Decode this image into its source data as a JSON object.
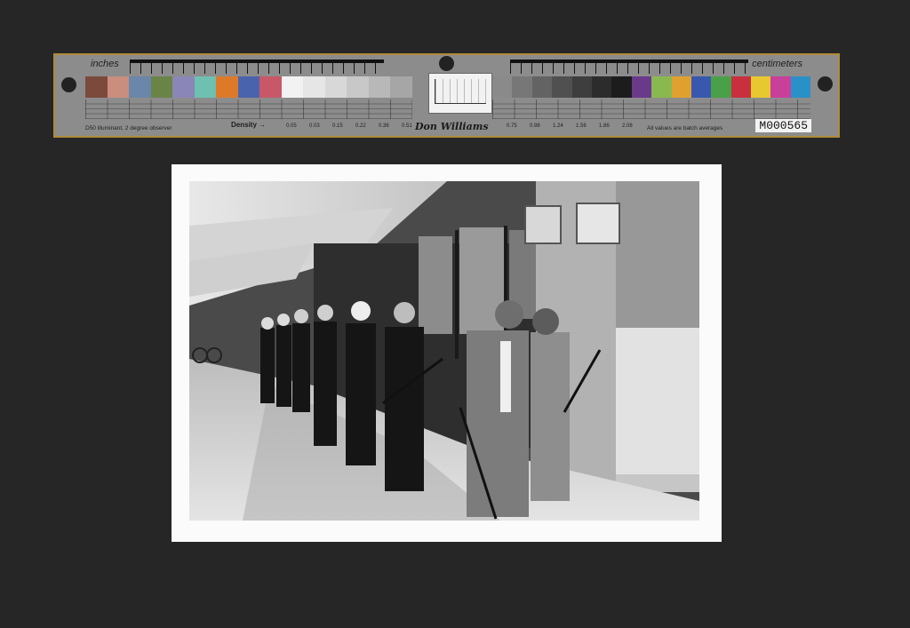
{
  "target": {
    "label_left": "inches",
    "label_right": "centimeters",
    "illuminant_note": "D50 illuminant, 2 degree observer",
    "density_label": "Density",
    "density_values_left": [
      "0.05",
      "0.03",
      "0.15",
      "0.22",
      "0.36",
      "0.51"
    ],
    "density_values_right": [
      "0.75",
      "0.98",
      "1.24",
      "1.56",
      "1.86",
      "2.08"
    ],
    "values_note": "All values are batch averages",
    "signature": "Don Williams",
    "item_id": "M000565",
    "left_patch_colors": [
      "#7b4a3c",
      "#c98e7e",
      "#6a86a8",
      "#6a8448",
      "#8a86b8",
      "#6ec0b0",
      "#dd7a2a",
      "#4a63ad",
      "#c85868",
      "#f2f2f2",
      "#e6e6e6",
      "#d8d8d8",
      "#c8c8c8",
      "#b8b8b8",
      "#a6a6a6"
    ],
    "right_patch_colors": [
      "#8a8a8a",
      "#777777",
      "#636363",
      "#505050",
      "#3e3e3e",
      "#2c2c2c",
      "#1c1c1c",
      "#6a3a8a",
      "#8ab850",
      "#e0a030",
      "#3858b0",
      "#4aa048",
      "#c83040",
      "#e8c830",
      "#c8409a",
      "#2a90c8"
    ]
  },
  "photo": {
    "subject": "black-and-white photograph of a line of helmeted police officers walking under a building overhang"
  }
}
